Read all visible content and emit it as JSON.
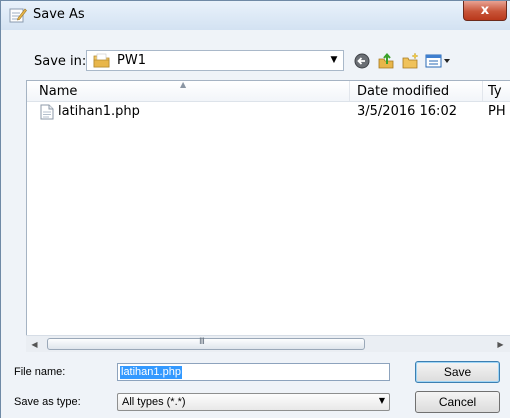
{
  "window": {
    "title": "Save As",
    "close_label": "x"
  },
  "toolbar": {
    "save_in_label": "Save in:",
    "location": "PW1",
    "icons": [
      "back-icon",
      "up-folder-icon",
      "new-folder-icon",
      "views-menu-icon"
    ]
  },
  "file_list": {
    "columns": [
      "Name",
      "Date modified",
      "Ty"
    ],
    "rows": [
      {
        "name": "latihan1.php",
        "date_modified": "3/5/2016 16:02",
        "type": "PH"
      }
    ]
  },
  "scrollbar": {
    "grip": "III"
  },
  "form": {
    "file_name_label": "File name:",
    "file_name_value": "latihan1.php",
    "save_as_type_label": "Save as type:",
    "save_as_type_value": "All types (*.*)",
    "save_button": "Save",
    "cancel_button": "Cancel"
  },
  "colors": {
    "accent": "#3399ff",
    "close_button": "#c85438",
    "folder": "#e8b64a"
  }
}
